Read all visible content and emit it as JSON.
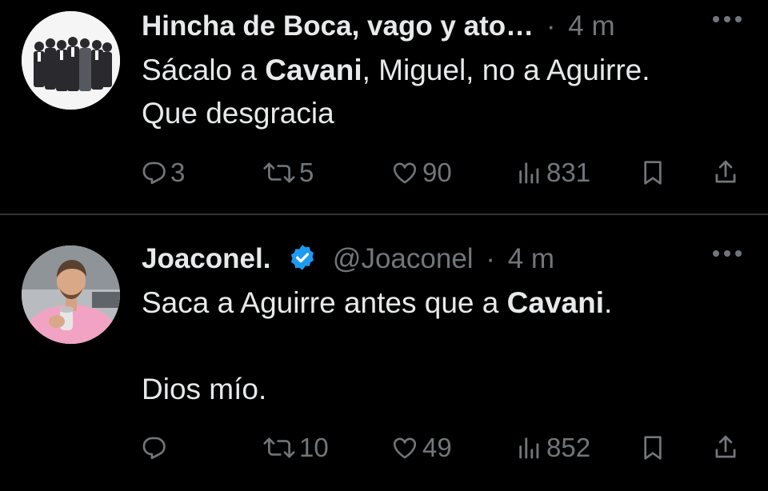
{
  "tweets": [
    {
      "display_name": "Hincha de Boca, vago y ato…",
      "handle": "",
      "separator": "·",
      "time": "4 m",
      "verified": false,
      "avatar": "group-photo-avatar",
      "text_lines": [
        [
          {
            "text": "Sácalo a ",
            "bold": false
          },
          {
            "text": "Cavani",
            "bold": true
          },
          {
            "text": ", Miguel, no a Aguirre.",
            "bold": false
          }
        ],
        [
          {
            "text": "Que desgracia",
            "bold": false
          }
        ]
      ],
      "actions": {
        "replies": "3",
        "reposts": "5",
        "likes": "90",
        "views": "831"
      }
    },
    {
      "display_name": "Joaconel.",
      "handle": "@Joaconel",
      "separator": "·",
      "time": "4 m",
      "verified": true,
      "avatar": "player-photo-avatar",
      "text_lines": [
        [
          {
            "text": "Saca a Aguirre antes que a ",
            "bold": false
          },
          {
            "text": "Cavani",
            "bold": true
          },
          {
            "text": ".",
            "bold": false
          }
        ],
        [],
        [
          {
            "text": "Dios mío.",
            "bold": false
          }
        ]
      ],
      "actions": {
        "replies": "",
        "reposts": "10",
        "likes": "49",
        "views": "852"
      }
    }
  ],
  "icons": {
    "reply": "reply-icon",
    "repost": "repost-icon",
    "like": "heart-icon",
    "views": "views-icon",
    "bookmark": "bookmark-icon",
    "share": "share-icon",
    "more": "more-icon",
    "verified": "verified-badge-icon"
  },
  "colors": {
    "background": "#000000",
    "text": "#e7e9ea",
    "muted": "#71767b",
    "divider": "#2f3336",
    "verified_blue": "#1d9bf0"
  }
}
